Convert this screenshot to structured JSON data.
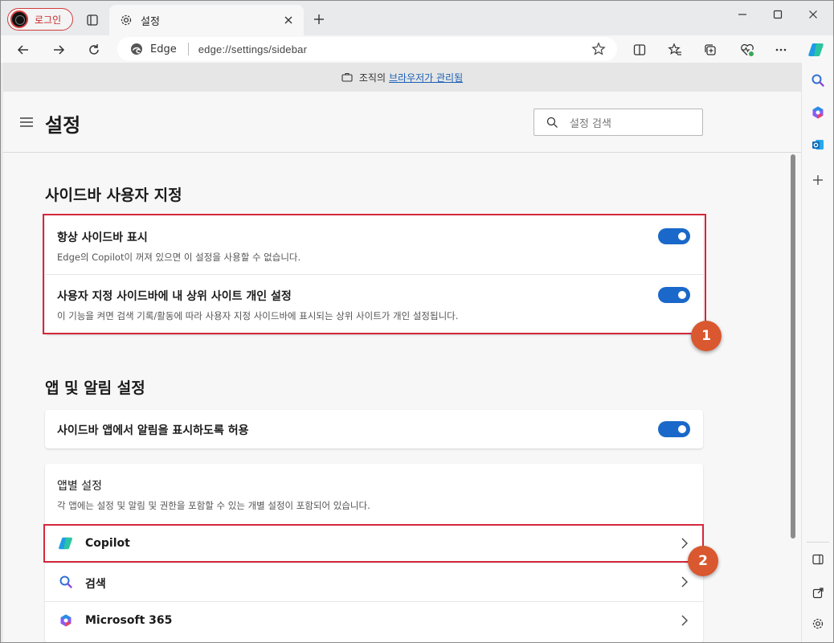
{
  "titlebar": {
    "profile_label": "로그인",
    "tab_title": "설정"
  },
  "toolbar": {
    "edge_label": "Edge",
    "url": "edge://settings/sidebar"
  },
  "managed_bar": {
    "text": "조직의",
    "link": "브라우저가 관리됨"
  },
  "header": {
    "title": "설정",
    "search_placeholder": "설정 검색"
  },
  "sidebar_section": {
    "title": "사이드바 사용자 지정",
    "rows": [
      {
        "title": "항상 사이드바 표시",
        "desc": "Edge의 Copilot이 꺼져 있으면 이 설정을 사용할 수 없습니다.",
        "on": true
      },
      {
        "title": "사용자 지정 사이드바에 내 상위 사이트 개인 설정",
        "desc": "이 기능을 켜면 검색 기록/활동에 따라 사용자 지정 사이드바에 표시되는 상위 사이트가 개인 설정됩니다.",
        "on": true
      }
    ]
  },
  "apps_section": {
    "title": "앱 및 알림 설정",
    "notify_row": {
      "title": "사이드바 앱에서 알림을 표시하도록 허용",
      "on": true
    },
    "per_app": {
      "title": "앱별 설정",
      "desc": "각 앱에는 설정 및 알림 및 권한을 포함할 수 있는 개별 설정이 포함되어 있습니다.",
      "apps": [
        {
          "label": "Copilot",
          "icon": "copilot-icon"
        },
        {
          "label": "검색",
          "icon": "search-icon"
        },
        {
          "label": "Microsoft 365",
          "icon": "microsoft-365-icon"
        }
      ]
    }
  },
  "markers": [
    "1",
    "2"
  ],
  "colors": {
    "accent": "#1a68c9",
    "highlight": "#d4283c",
    "marker": "#d9582f",
    "link": "#1a5fb4"
  }
}
